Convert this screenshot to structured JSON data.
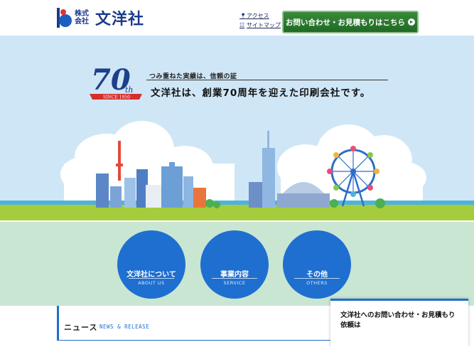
{
  "header": {
    "logo_kabu": "株式会社",
    "logo_name": "文洋社",
    "links": [
      {
        "label": "アクセス",
        "icon": "map-pin-icon"
      },
      {
        "label": "サイトマップ",
        "icon": "sitemap-icon"
      }
    ],
    "contact_button": "お問い合わせ・お見積もりはこちら"
  },
  "hero": {
    "badge_number": "70",
    "badge_suffix": "th",
    "badge_since": "SINCE 1950",
    "tagline_small": "つみ重ねた実績は、信頼の証",
    "tagline_big": "文洋社は、創業70周年を迎えた印刷会社です。"
  },
  "nav": [
    {
      "jp": "文洋社について",
      "en": "ABOUT US"
    },
    {
      "jp": "事業内容",
      "en": "SERVICE"
    },
    {
      "jp": "その他",
      "en": "OTHERS"
    }
  ],
  "news": {
    "title": "ニュース",
    "subtitle": "NEWS & RELEASE"
  },
  "float_panel": {
    "text": "文洋社へのお問い合わせ・お見積もり依頼は"
  },
  "colors": {
    "brand_blue": "#1e6fd0",
    "button_green": "#1f6a25",
    "sky": "#cfe6f6",
    "grass": "#a5cc3c",
    "nav_bg": "#c9e6d3"
  }
}
